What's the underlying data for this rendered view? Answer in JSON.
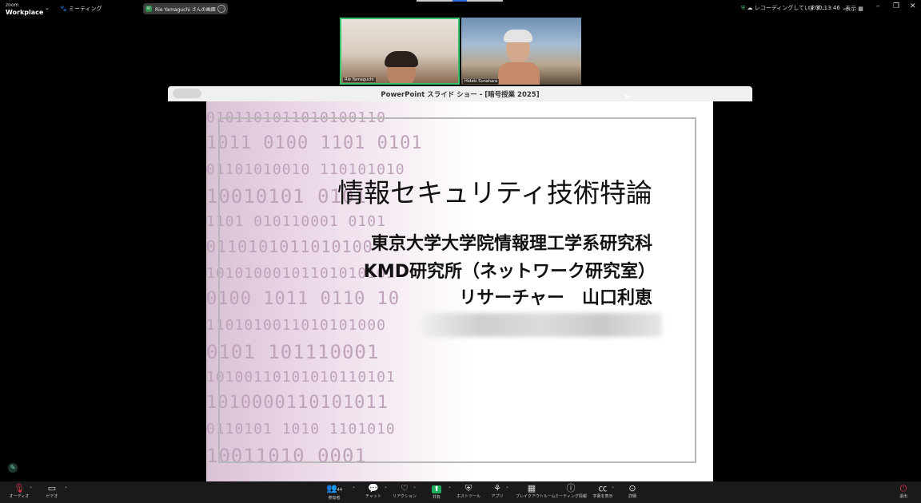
{
  "app": {
    "logo_line1": "zoom",
    "logo_line2": "Workplace",
    "meeting_label": "ミーティング",
    "share_initials": "RY",
    "share_label": "Rie Yamaguchi さんの画面",
    "recording_label": "レコーディングしています...",
    "timer": "00:13:46",
    "view_label": "表示"
  },
  "participants": [
    {
      "name": "Rie Yamaguchi"
    },
    {
      "name": "Hideki Sunahara"
    }
  ],
  "slideshow": {
    "window_title": "PowerPoint スライド ショー - [暗号授業 2025]",
    "title": "情報セキュリティ技術特論",
    "line1": "東京大学大学院情報理工学系研究科",
    "line2": "KMD研究所（ネットワーク研究室）",
    "line3": "リサーチャー　山口利恵"
  },
  "toolbar": {
    "audio": "オーディオ",
    "video": "ビデオ",
    "participants": "参加者",
    "participants_count": "44",
    "chat": "チャット",
    "reaction": "リアクション",
    "share": "共有",
    "host_tools": "ホストツール",
    "apps": "アプリ",
    "breakout": "ブレイクアウトルーム",
    "meeting_info": "ミーティング情報",
    "captions": "字幕を表示",
    "more": "詳細",
    "leave": "退出"
  },
  "colors": {
    "active_speaker": "#35c46a",
    "share_green": "#1fae5b",
    "muted_red": "#e0344b"
  }
}
